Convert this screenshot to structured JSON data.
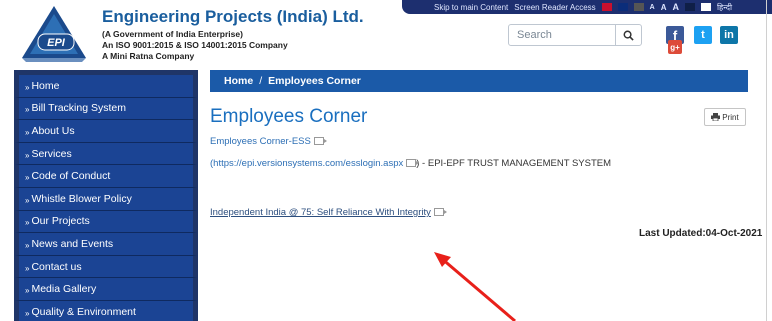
{
  "access_bar": {
    "skip_link": "Skip to main Content",
    "screen_reader": "Screen Reader Access",
    "font_sizes": [
      "A",
      "A",
      "A"
    ],
    "language": "हिन्दी",
    "colors": [
      "#c8102e",
      "#0b2d7a",
      "#555555",
      "#0f1f47",
      "#ffffff"
    ]
  },
  "header": {
    "org_name": "Engineering Projects (India) Ltd.",
    "sub1": "(A Government of India Enterprise)",
    "sub2": "An ISO 9001:2015 & ISO 14001:2015 Company",
    "sub3": "A Mini Ratna Company",
    "logo_text": "EPI"
  },
  "search": {
    "placeholder": "Search",
    "icon": "search-icon"
  },
  "social": {
    "facebook": "f",
    "twitter": "t",
    "linkedin": "in",
    "googleplus": "g+"
  },
  "sidebar": {
    "items": [
      {
        "label": "Home"
      },
      {
        "label": "Bill Tracking System"
      },
      {
        "label": "About Us"
      },
      {
        "label": "Services"
      },
      {
        "label": "Code of Conduct"
      },
      {
        "label": "Whistle Blower Policy"
      },
      {
        "label": "Our Projects"
      },
      {
        "label": "News and Events"
      },
      {
        "label": "Contact us"
      },
      {
        "label": "Media Gallery"
      },
      {
        "label": "Quality & Environment"
      }
    ]
  },
  "breadcrumb": {
    "home": "Home",
    "separator": "/",
    "current": "Employees Corner"
  },
  "main": {
    "title": "Employees Corner",
    "print_label": "Print",
    "ess_link": "Employees Corner-ESS",
    "ess_url": "(https://epi.versionsystems.com/esslogin.aspx",
    "ess_url_suffix": ") - EPI-EPF TRUST MANAGEMENT SYSTEM",
    "independent_link": "Independent India @ 75: Self Reliance With Integrity",
    "last_updated": "Last Updated:04-Oct-2021"
  },
  "colors": {
    "brand_blue": "#1a5e9e",
    "sidebar_bg": "#1b4494",
    "breadcrumb_bg": "#1b5aa8",
    "annotation_arrow": "#e8201a"
  }
}
